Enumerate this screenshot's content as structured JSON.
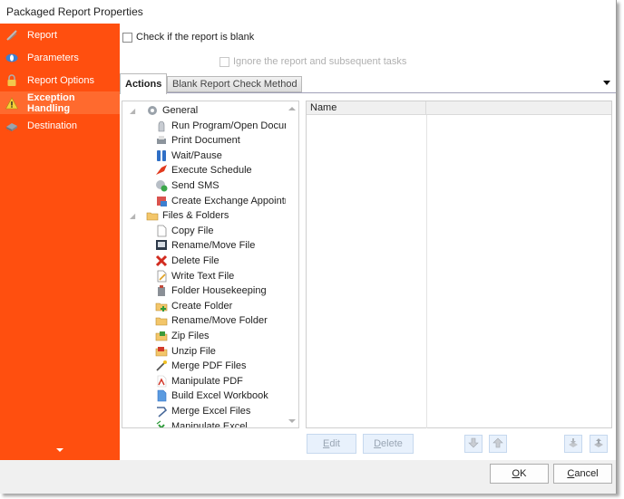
{
  "window": {
    "title": "Packaged Report Properties"
  },
  "sidebar": {
    "items": [
      {
        "label": "Report",
        "icon": "wand-icon",
        "active": false
      },
      {
        "label": "Parameters",
        "icon": "parameters-icon",
        "active": false
      },
      {
        "label": "Report Options",
        "icon": "lock-icon",
        "active": false
      },
      {
        "label": "Exception Handling",
        "icon": "warning-icon",
        "active": true
      },
      {
        "label": "Destination",
        "icon": "printer-icon",
        "active": false
      }
    ],
    "more_icon": "chevron-down-icon"
  },
  "options": {
    "check_blank_label": "Check if the report is blank",
    "check_blank_checked": false,
    "ignore_label": "Ignore the report and subsequent tasks",
    "ignore_checked": false,
    "ignore_enabled": false
  },
  "tabs": [
    {
      "label": "Actions",
      "active": true
    },
    {
      "label": "Blank Report Check Method",
      "active": false
    }
  ],
  "tree": {
    "groups": [
      {
        "label": "General",
        "icon": "gear-icon",
        "items": [
          {
            "label": "Run Program/Open Document",
            "icon": "program-icon"
          },
          {
            "label": "Print Document",
            "icon": "printer-icon"
          },
          {
            "label": "Wait/Pause",
            "icon": "pause-icon"
          },
          {
            "label": "Execute Schedule",
            "icon": "schedule-icon"
          },
          {
            "label": "Send SMS",
            "icon": "sms-icon"
          },
          {
            "label": "Create Exchange Appointment",
            "icon": "calendar-icon"
          }
        ]
      },
      {
        "label": "Files & Folders",
        "icon": "folder-icon",
        "items": [
          {
            "label": "Copy File",
            "icon": "copy-file-icon"
          },
          {
            "label": "Rename/Move File",
            "icon": "rename-file-icon"
          },
          {
            "label": "Delete File",
            "icon": "delete-icon"
          },
          {
            "label": "Write Text File",
            "icon": "write-file-icon"
          },
          {
            "label": "Folder Housekeeping",
            "icon": "housekeeping-icon"
          },
          {
            "label": "Create Folder",
            "icon": "create-folder-icon"
          },
          {
            "label": "Rename/Move Folder",
            "icon": "rename-folder-icon"
          },
          {
            "label": "Zip Files",
            "icon": "zip-icon"
          },
          {
            "label": "Unzip File",
            "icon": "unzip-icon"
          },
          {
            "label": "Merge PDF Files",
            "icon": "merge-pdf-icon"
          },
          {
            "label": "Manipulate PDF",
            "icon": "pdf-icon"
          },
          {
            "label": "Build Excel Workbook",
            "icon": "excel-workbook-icon"
          },
          {
            "label": "Merge Excel Files",
            "icon": "merge-excel-icon"
          },
          {
            "label": "Manipulate Excel",
            "icon": "excel-icon"
          }
        ]
      }
    ]
  },
  "grid": {
    "columns": [
      "Name",
      ""
    ],
    "rows": []
  },
  "action_buttons": {
    "edit": "Edit",
    "edit_mnemonic": "E",
    "delete": "Delete",
    "delete_mnemonic": "D",
    "move_down_icon": "arrow-down-icon",
    "move_up_icon": "arrow-up-icon",
    "import_icon": "import-icon",
    "export_icon": "export-icon"
  },
  "footer": {
    "ok": "OK",
    "ok_mnemonic": "O",
    "cancel": "Cancel",
    "cancel_mnemonic": "C"
  },
  "colors": {
    "sidebar_bg": "#ff4f0f",
    "sidebar_active": "#ff6a2e",
    "footer_bg": "#f0f0f0"
  }
}
